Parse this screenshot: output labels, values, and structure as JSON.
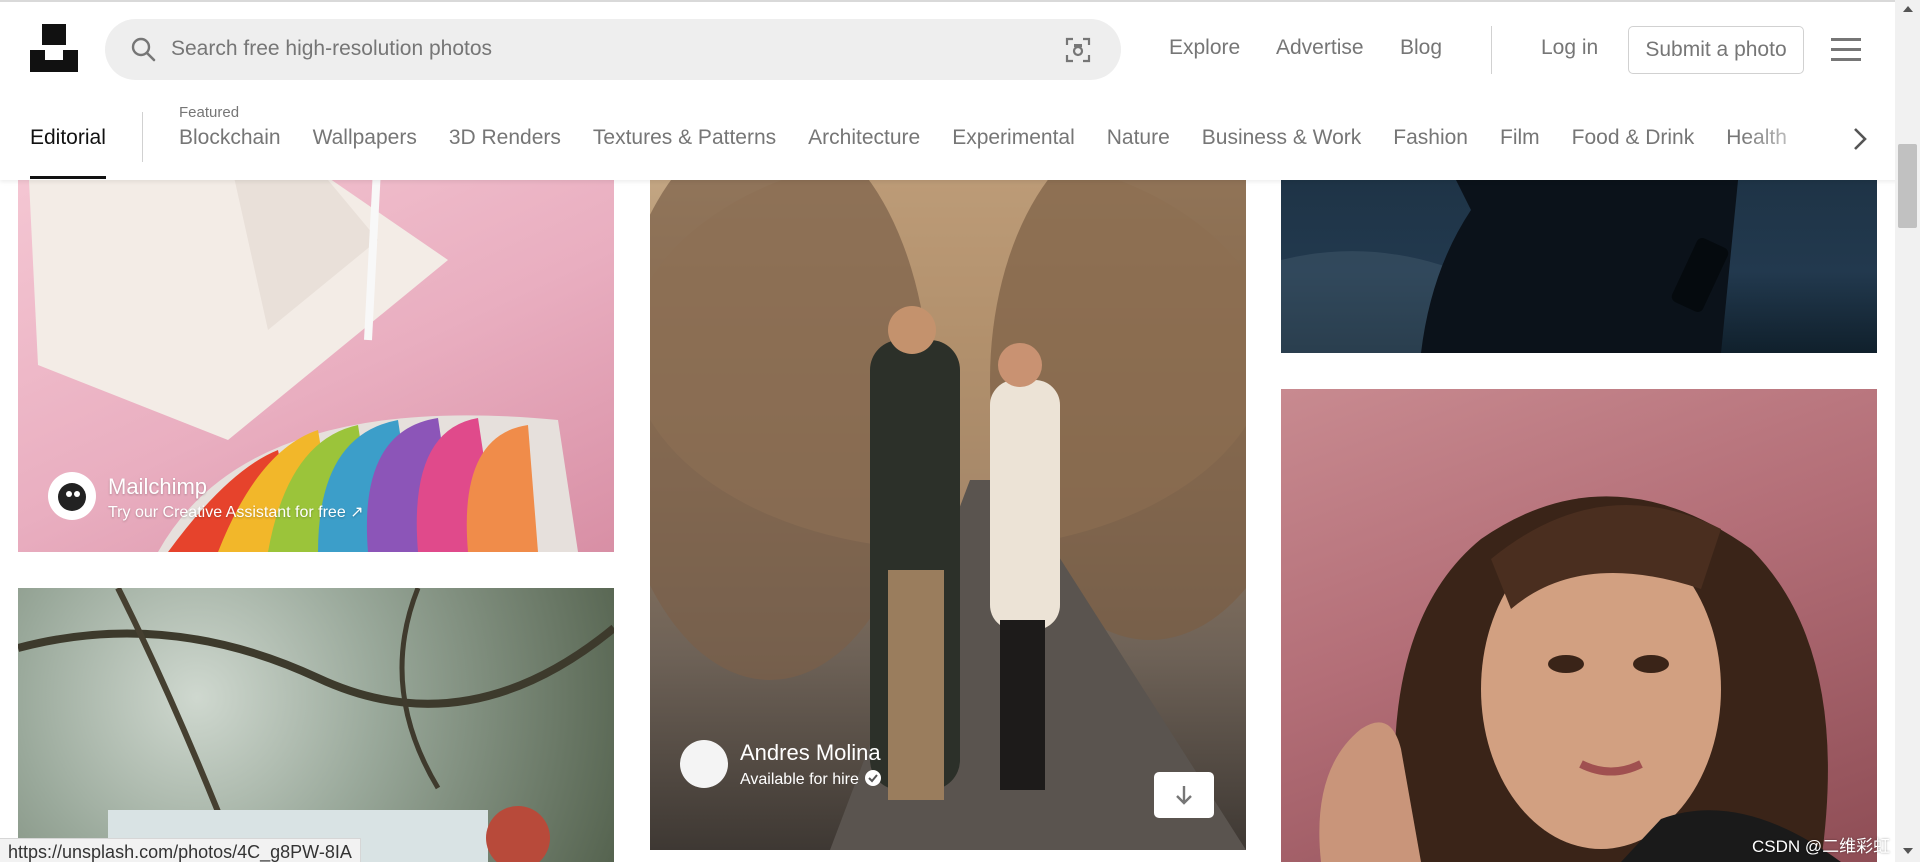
{
  "header": {
    "search_placeholder": "Search free high-resolution photos",
    "nav": {
      "explore": "Explore",
      "advertise": "Advertise",
      "blog": "Blog",
      "login": "Log in"
    },
    "submit_label": "Submit a photo"
  },
  "categories": {
    "active": "Editorial",
    "featured_label": "Featured",
    "items": [
      "Blockchain",
      "Wallpapers",
      "3D Renders",
      "Textures & Patterns",
      "Architecture",
      "Experimental",
      "Nature",
      "Business & Work",
      "Fashion",
      "Film",
      "Food & Drink",
      "Health"
    ]
  },
  "photos": {
    "sponsored": {
      "name": "Mailchimp",
      "subtitle": "Try our Creative Assistant for free ↗"
    },
    "featured": {
      "author": "Andres Molina",
      "status": "Available for hire"
    }
  },
  "status_bar": {
    "url": "https://unsplash.com/photos/4C_g8PW-8IA"
  },
  "watermark": "CSDN @二维彩虹",
  "icons": [
    "unsplash-logo",
    "search-icon",
    "visual-search-icon",
    "menu-icon",
    "chevron-right-icon",
    "download-icon",
    "verified-check-icon"
  ]
}
